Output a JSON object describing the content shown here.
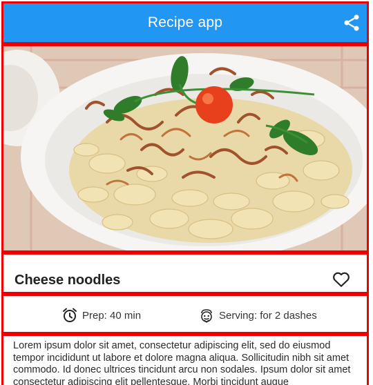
{
  "appbar": {
    "title": "Recipe app",
    "share_icon": "share-icon"
  },
  "recipe": {
    "title": "Cheese noodles",
    "favorite_icon": "heart-outline-icon",
    "prep_label": "Prep: 40 min",
    "serving_label": "Serving: for 2 dashes",
    "description": "Lorem ipsum dolor sit amet, consectetur adipiscing elit, sed do eiusmod tempor incididunt ut labore et dolore magna aliqua. Sollicitudin nibh sit amet commodo. Id donec ultrices tincidunt arcu non sodales. Ipsum dolor sit amet consectetur adipiscing elit pellentesque. Morbi tincidunt augue"
  },
  "colors": {
    "appbar": "#2196f3",
    "outline": "#ee0000"
  }
}
